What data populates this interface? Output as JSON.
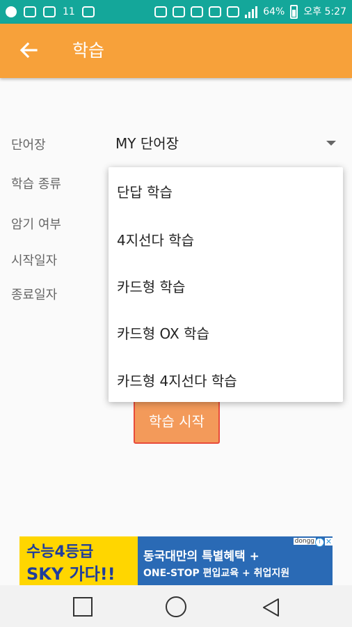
{
  "status_bar": {
    "network": "11",
    "battery_percent": "64%",
    "time": "오후 5:27"
  },
  "app_bar": {
    "title": "학습",
    "back_icon": "arrow-left-icon"
  },
  "form": {
    "labels": [
      "단어장",
      "학습 종류",
      "암기 여부",
      "시작일자",
      "종료일자"
    ],
    "wordbook_value": "MY 단어장"
  },
  "dropdown": {
    "options": [
      "단답 학습",
      "4지선다 학습",
      "카드형 학습",
      "카드형 OX 학습",
      "카드형 4지선다 학습"
    ]
  },
  "start_button": {
    "label": "학습 시작"
  },
  "ad": {
    "left_line1": "수능4등급",
    "left_line2": "SKY 가다!!",
    "right_line1": "동국대만의 특별혜택 +",
    "right_line2": "ONE-STOP 편입교육 + 취업지원",
    "brand": "dongg"
  },
  "colors": {
    "status_bar": "#14a79a",
    "app_bar": "#f7a13a",
    "button": "#f39a5a",
    "button_border": "#e84a3a"
  }
}
